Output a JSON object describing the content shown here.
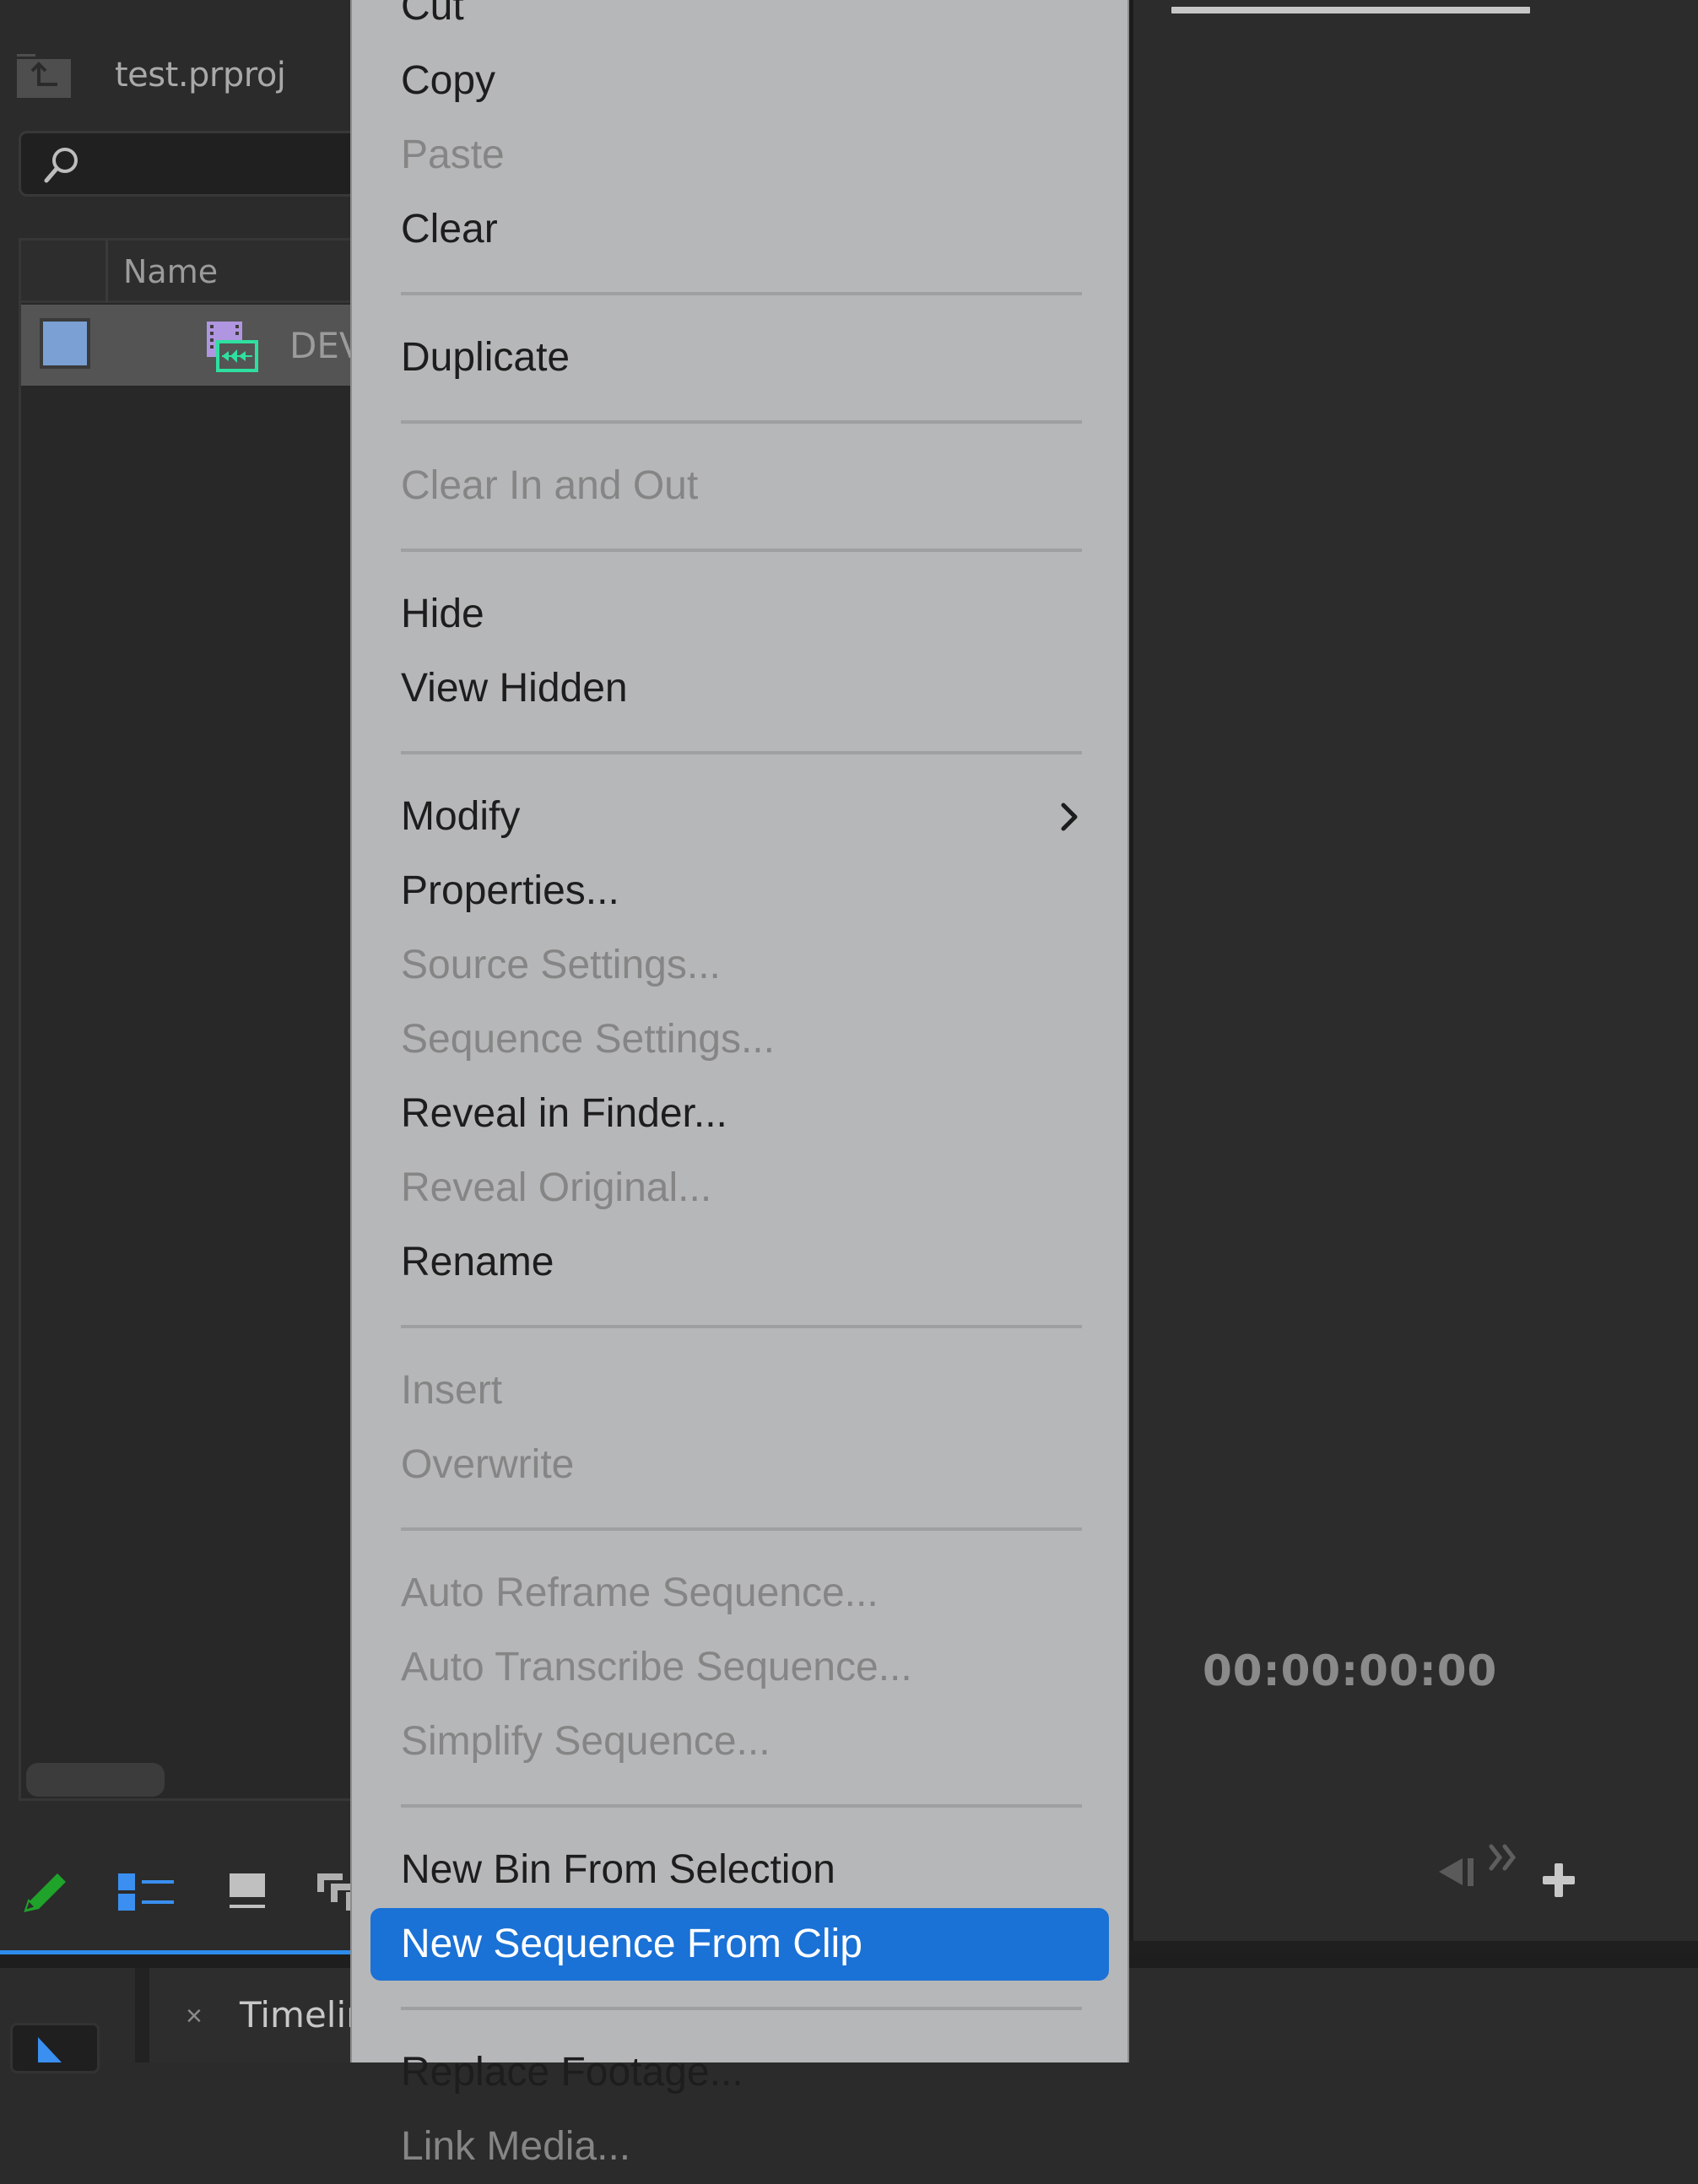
{
  "project_panel": {
    "title": "test.prproj",
    "search": {
      "placeholder": "",
      "value": ""
    },
    "columns": {
      "name": "Name"
    },
    "rows": [
      {
        "name": "DEV",
        "label_color": "#7aa0d4",
        "icon": "av-clip-icon"
      }
    ],
    "toolbar_icons": [
      "pencil-icon",
      "list-view-icon",
      "icon-view-icon",
      "freeform-view-icon"
    ]
  },
  "bottom": {
    "timeline_tab": {
      "close": "×",
      "label": "Timeline"
    }
  },
  "right_panel": {
    "timecode": "00:00:00:00",
    "icons": [
      "step-back-icon",
      "more-icon",
      "add-icon"
    ]
  },
  "context_menu": {
    "highlight_color": "#1a71d6",
    "items": [
      {
        "label": "Cut",
        "enabled": true
      },
      {
        "label": "Copy",
        "enabled": true
      },
      {
        "label": "Paste",
        "enabled": false
      },
      {
        "label": "Clear",
        "enabled": true
      },
      {
        "separator": true
      },
      {
        "label": "Duplicate",
        "enabled": true
      },
      {
        "separator": true
      },
      {
        "label": "Clear In and Out",
        "enabled": false
      },
      {
        "separator": true
      },
      {
        "label": "Hide",
        "enabled": true
      },
      {
        "label": "View Hidden",
        "enabled": true
      },
      {
        "separator": true
      },
      {
        "label": "Modify",
        "enabled": true,
        "submenu": true
      },
      {
        "label": "Properties...",
        "enabled": true
      },
      {
        "label": "Source Settings...",
        "enabled": false
      },
      {
        "label": "Sequence Settings...",
        "enabled": false
      },
      {
        "label": "Reveal in Finder...",
        "enabled": true
      },
      {
        "label": "Reveal Original...",
        "enabled": false
      },
      {
        "label": "Rename",
        "enabled": true
      },
      {
        "separator": true
      },
      {
        "label": "Insert",
        "enabled": false
      },
      {
        "label": "Overwrite",
        "enabled": false
      },
      {
        "separator": true
      },
      {
        "label": "Auto Reframe Sequence...",
        "enabled": false
      },
      {
        "label": "Auto Transcribe Sequence...",
        "enabled": false
      },
      {
        "label": "Simplify Sequence...",
        "enabled": false
      },
      {
        "separator": true
      },
      {
        "label": "New Bin From Selection",
        "enabled": true
      },
      {
        "label": "New Sequence From Clip",
        "enabled": true,
        "highlighted": true
      },
      {
        "separator": true
      },
      {
        "label": "Replace Footage...",
        "enabled": true
      },
      {
        "label": "Link Media...",
        "enabled": false
      }
    ]
  }
}
